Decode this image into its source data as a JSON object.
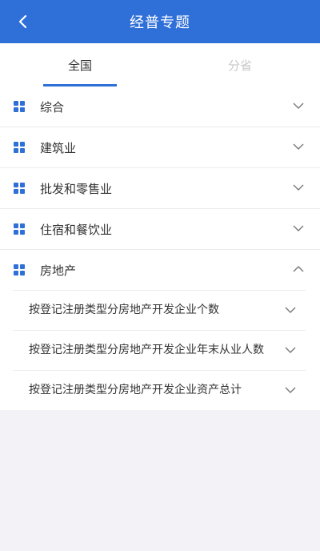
{
  "header": {
    "title": "经普专题",
    "back_icon": "chevron-left-icon"
  },
  "tabs": [
    {
      "label": "全国",
      "active": true
    },
    {
      "label": "分省",
      "active": false
    }
  ],
  "categories": [
    {
      "label": "综合",
      "expanded": false
    },
    {
      "label": "建筑业",
      "expanded": false
    },
    {
      "label": "批发和零售业",
      "expanded": false
    },
    {
      "label": "住宿和餐饮业",
      "expanded": false
    },
    {
      "label": "房地产",
      "expanded": true
    }
  ],
  "real_estate_items": [
    {
      "label": "按登记注册类型分房地产开发企业个数"
    },
    {
      "label": "按登记注册类型分房地产开发企业年末从业人数"
    },
    {
      "label": "按登记注册类型分房地产开发企业资产总计"
    }
  ],
  "colors": {
    "primary": "#2f6fd8",
    "background": "#f3f2f7"
  }
}
